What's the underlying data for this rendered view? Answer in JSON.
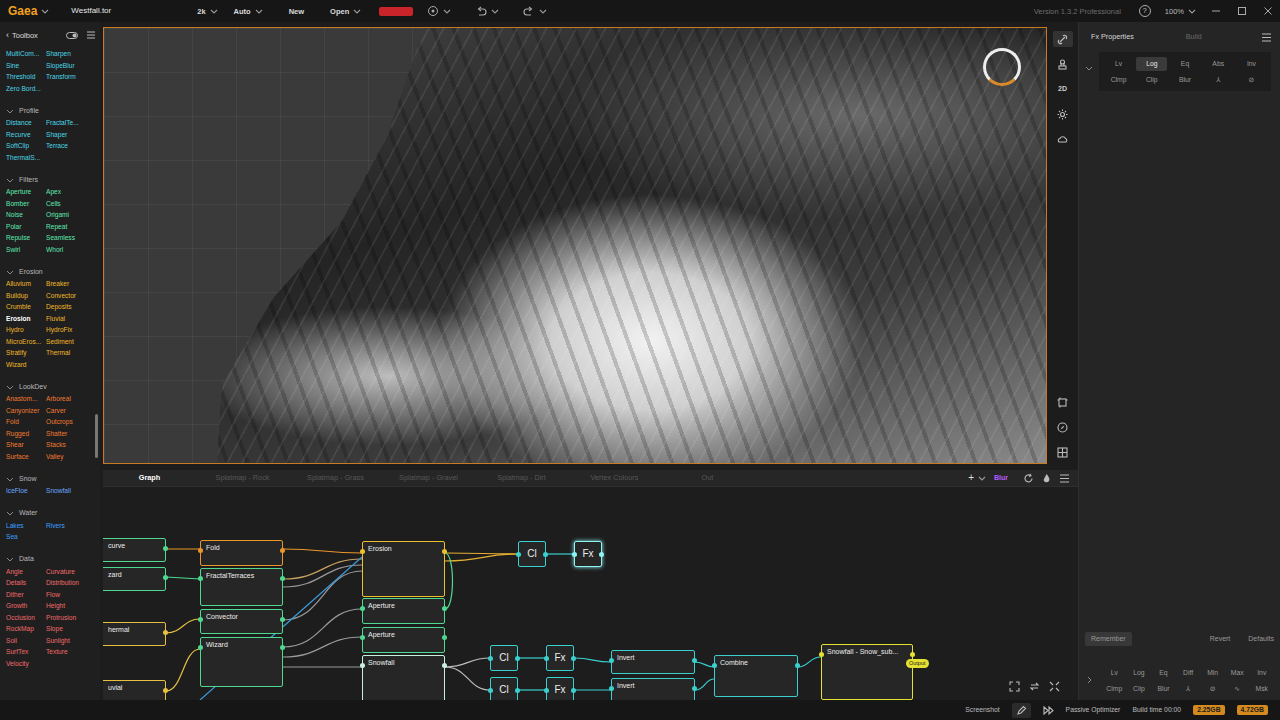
{
  "topbar": {
    "logo": "Gaea",
    "file": "Westfall.tor",
    "resolution": "2k",
    "mode": "Auto",
    "menu": [
      {
        "label": "New",
        "dropdown": false
      },
      {
        "label": "Open",
        "dropdown": true
      }
    ],
    "version": "Version 1.3.2 Professional",
    "help": "?",
    "zoom": "100%"
  },
  "toolbox": {
    "back": "‹",
    "title": "Toolbox",
    "sections": [
      {
        "title": null,
        "color": "#4ad6e6",
        "items": [
          {
            "label": "MultiCom...",
            "selected": false
          },
          {
            "label": "Sharpen",
            "selected": false
          },
          {
            "label": "Sine",
            "selected": false
          },
          {
            "label": "SlopeBlur",
            "selected": false
          },
          {
            "label": "Threshold",
            "selected": false
          },
          {
            "label": "Transform",
            "selected": false
          },
          {
            "label": "Zero Bord...",
            "selected": false
          }
        ]
      },
      {
        "title": "Profile",
        "color": "#4ad6e6",
        "items": [
          {
            "label": "Distance",
            "selected": false
          },
          {
            "label": "FractalTe...",
            "selected": false
          },
          {
            "label": "Recurve",
            "selected": false
          },
          {
            "label": "Shaper",
            "selected": false
          },
          {
            "label": "SoftClip",
            "selected": false
          },
          {
            "label": "Terrace",
            "selected": false
          },
          {
            "label": "ThermalS...",
            "selected": false
          }
        ]
      },
      {
        "title": "Filters",
        "color": "#5ee8b0",
        "items": [
          {
            "label": "Aperture",
            "selected": false
          },
          {
            "label": "Apex",
            "selected": false
          },
          {
            "label": "Bomber",
            "selected": false
          },
          {
            "label": "Cells",
            "selected": false
          },
          {
            "label": "Noise",
            "selected": false
          },
          {
            "label": "Origami",
            "selected": false
          },
          {
            "label": "Polar",
            "selected": false
          },
          {
            "label": "Repeat",
            "selected": false
          },
          {
            "label": "Repulse",
            "selected": false
          },
          {
            "label": "Seamless",
            "selected": false
          },
          {
            "label": "Swirl",
            "selected": false
          },
          {
            "label": "Whorl",
            "selected": false
          }
        ]
      },
      {
        "title": "Erosion",
        "color": "#f0b828",
        "items": [
          {
            "label": "Alluvium",
            "selected": false
          },
          {
            "label": "Breaker",
            "selected": false
          },
          {
            "label": "Buildup",
            "selected": false
          },
          {
            "label": "Convector",
            "selected": false
          },
          {
            "label": "Crumble",
            "selected": false
          },
          {
            "label": "Deposits",
            "selected": false
          },
          {
            "label": "Erosion",
            "selected": true
          },
          {
            "label": "Fluvial",
            "selected": false
          },
          {
            "label": "Hydro",
            "selected": false
          },
          {
            "label": "HydroFix",
            "selected": false
          },
          {
            "label": "MicroEros...",
            "selected": false
          },
          {
            "label": "Sediment",
            "selected": false
          },
          {
            "label": "Stratify",
            "selected": false
          },
          {
            "label": "Thermal",
            "selected": false
          },
          {
            "label": "Wizard",
            "selected": false
          }
        ]
      },
      {
        "title": "LookDev",
        "color": "#f07a30",
        "items": [
          {
            "label": "Anastom...",
            "selected": false
          },
          {
            "label": "Arboreal",
            "selected": false
          },
          {
            "label": "Canyonizer",
            "selected": false
          },
          {
            "label": "Carver",
            "selected": false
          },
          {
            "label": "Fold",
            "selected": false
          },
          {
            "label": "Outcrops",
            "selected": false
          },
          {
            "label": "Rugged",
            "selected": false
          },
          {
            "label": "Shatter",
            "selected": false
          },
          {
            "label": "Shear",
            "selected": false
          },
          {
            "label": "Stacks",
            "selected": false
          },
          {
            "label": "Surface",
            "selected": false
          },
          {
            "label": "Valley",
            "selected": false
          }
        ]
      },
      {
        "title": "Snow",
        "color": "#6aa8ff",
        "items": [
          {
            "label": "IceFloe",
            "selected": false
          },
          {
            "label": "Snowfall",
            "selected": false
          }
        ]
      },
      {
        "title": "Water",
        "color": "#3aa0ff",
        "items": [
          {
            "label": "Lakes",
            "selected": false
          },
          {
            "label": "Rivers",
            "selected": false
          },
          {
            "label": "Sea",
            "selected": false
          }
        ]
      },
      {
        "title": "Data",
        "color": "#f06a6a",
        "items": [
          {
            "label": "Angle",
            "selected": false
          },
          {
            "label": "Curvature",
            "selected": false
          },
          {
            "label": "Details",
            "selected": false
          },
          {
            "label": "Distribution",
            "selected": false
          },
          {
            "label": "Dither",
            "selected": false
          },
          {
            "label": "Flow",
            "selected": false
          },
          {
            "label": "Growth",
            "selected": false
          },
          {
            "label": "Height",
            "selected": false
          },
          {
            "label": "Occlusion",
            "selected": false
          },
          {
            "label": "Protrusion",
            "selected": false
          },
          {
            "label": "RockMap",
            "selected": false
          },
          {
            "label": "Slope",
            "selected": false
          },
          {
            "label": "Soil",
            "selected": false
          },
          {
            "label": "Sunlight",
            "selected": false
          },
          {
            "label": "SurfTex",
            "selected": false
          },
          {
            "label": "Texture",
            "selected": false
          },
          {
            "label": "Velocity",
            "selected": false
          }
        ]
      }
    ]
  },
  "viewport": {
    "loading": true,
    "view_label": "2D"
  },
  "graph": {
    "tabs": [
      {
        "label": "Graph",
        "selected": true
      },
      {
        "label": "Splatmap - Rock",
        "selected": false
      },
      {
        "label": "Splatmap - Grass",
        "selected": false
      },
      {
        "label": "Splatmap - Gravel",
        "selected": false
      },
      {
        "label": "Splatmap - Dirt",
        "selected": false
      },
      {
        "label": "Vertex Colours",
        "selected": false
      },
      {
        "label": "Out",
        "selected": false
      }
    ],
    "add": "+",
    "filter": "Blur",
    "nodes": [
      {
        "label": "curve",
        "kind": "edge",
        "color": "#4fd890",
        "selected": false
      },
      {
        "label": "zard",
        "kind": "edge",
        "color": "#4fd890",
        "selected": false
      },
      {
        "label": "hermal",
        "kind": "edge",
        "color": "#e8c040",
        "selected": false
      },
      {
        "label": "uvial",
        "kind": "edge",
        "color": "#e8c040",
        "selected": false
      },
      {
        "label": "Fold",
        "kind": "block",
        "color": "#e8962a",
        "selected": false
      },
      {
        "label": "FractalTerraces",
        "kind": "block",
        "color": "#4fd890",
        "selected": false
      },
      {
        "label": "Convector",
        "kind": "block",
        "color": "#4fd890",
        "selected": false
      },
      {
        "label": "Wizard",
        "kind": "block",
        "color": "#4fd890",
        "selected": false
      },
      {
        "label": "Erosion",
        "kind": "block",
        "color": "#e8c030",
        "selected": false
      },
      {
        "label": "Aperture",
        "kind": "block",
        "color": "#4fd890",
        "selected": false
      },
      {
        "label": "Aperture",
        "kind": "block",
        "color": "#4fd890",
        "selected": false
      },
      {
        "label": "Snowfall",
        "kind": "block",
        "color": "#c8f0e0",
        "selected": false
      },
      {
        "label": "Cl",
        "kind": "small",
        "color": "#3ad0d0",
        "selected": false
      },
      {
        "label": "Fx",
        "kind": "small",
        "color": "#8ff4f4",
        "selected": true
      },
      {
        "label": "Cl",
        "kind": "small",
        "color": "#3ad0d0",
        "selected": false
      },
      {
        "label": "Fx",
        "kind": "small",
        "color": "#3ad0d0",
        "selected": false
      },
      {
        "label": "Cl",
        "kind": "small",
        "color": "#3ad0d0",
        "selected": false
      },
      {
        "label": "Fx",
        "kind": "small",
        "color": "#3ad0d0",
        "selected": false
      },
      {
        "label": "Invert",
        "kind": "block",
        "color": "#3ad0d0",
        "selected": false
      },
      {
        "label": "Invert",
        "kind": "block",
        "color": "#3ad0d0",
        "selected": false
      },
      {
        "label": "Combine",
        "kind": "block",
        "color": "#3ad0d0",
        "selected": false
      },
      {
        "label": "Snowfall - Snow_sub...",
        "kind": "block",
        "color": "#e6e030",
        "selected": false,
        "badge": "Output"
      }
    ]
  },
  "properties": {
    "tabs": [
      {
        "label": "Fx Properties",
        "selected": true
      },
      {
        "label": "Build",
        "selected": false
      }
    ],
    "fx_rows": [
      [
        {
          "label": "Lv",
          "selected": false
        },
        {
          "label": "Log",
          "selected": true
        },
        {
          "label": "Eq",
          "selected": false
        },
        {
          "label": "Abs",
          "selected": false
        },
        {
          "label": "Inv",
          "selected": false
        }
      ],
      [
        {
          "label": "Clmp",
          "selected": false
        },
        {
          "label": "Clip",
          "selected": false
        },
        {
          "label": "Blur",
          "selected": false
        },
        {
          "label": "⅄",
          "selected": false
        },
        {
          "label": "⊘",
          "selected": false
        }
      ]
    ],
    "actions": [
      "Remember",
      "Revert",
      "Defaults"
    ],
    "quick_rows": [
      [
        "Lv",
        "Log",
        "Eq",
        "Diff",
        "Min",
        "Max",
        "Inv"
      ],
      [
        "Clmp",
        "Clip",
        "Blur",
        "⅄",
        "⊘",
        "∿",
        "Msk"
      ]
    ]
  },
  "status_bar": {
    "screenshot": "Screenshot",
    "optimizer": "Passive Optimizer",
    "build_time": "Build time 00:00",
    "memory": [
      "2.25GB",
      "4.72GB"
    ]
  }
}
